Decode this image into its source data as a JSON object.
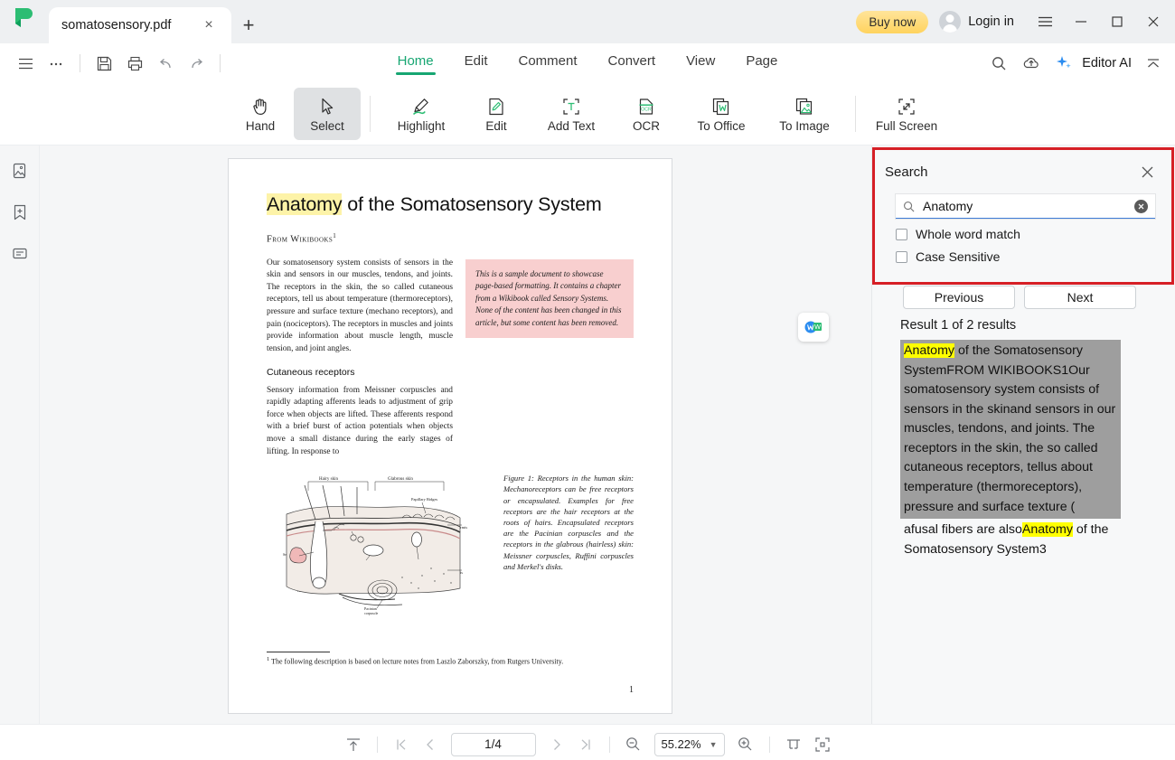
{
  "titlebar": {
    "logo_name": "app-logo",
    "tab_title": "somatosensory.pdf",
    "close_label": "×",
    "newtab_label": "+",
    "buy_now": "Buy now",
    "login": "Login in",
    "minimize": "—",
    "maximize": "□",
    "close": "×"
  },
  "ribbon": {
    "menus": [
      {
        "label": "Home",
        "active": true
      },
      {
        "label": "Edit",
        "active": false
      },
      {
        "label": "Comment",
        "active": false
      },
      {
        "label": "Convert",
        "active": false
      },
      {
        "label": "View",
        "active": false
      },
      {
        "label": "Page",
        "active": false
      }
    ],
    "editor_ai": "Editor AI",
    "accent": "#17a672"
  },
  "tools": [
    {
      "label": "Hand",
      "icon": "hand-icon",
      "selected": false
    },
    {
      "label": "Select",
      "icon": "cursor-icon",
      "selected": true
    },
    {
      "label": "Highlight",
      "icon": "highlighter-icon",
      "selected": false
    },
    {
      "label": "Edit",
      "icon": "edit-page-icon",
      "selected": false
    },
    {
      "label": "Add Text",
      "icon": "add-text-icon",
      "selected": false
    },
    {
      "label": "OCR",
      "icon": "ocr-icon",
      "selected": false
    },
    {
      "label": "To Office",
      "icon": "to-office-icon",
      "selected": false
    },
    {
      "label": "To Image",
      "icon": "to-image-icon",
      "selected": false
    },
    {
      "label": "Full Screen",
      "icon": "full-screen-icon",
      "selected": false
    }
  ],
  "document": {
    "title_highlight": "Anatomy",
    "title_rest": " of the Somatosensory System",
    "from": "From Wikibooks",
    "from_sup": "1",
    "paragraph1": "Our somatosensory system consists of sensors in the skin and sensors in our muscles, tendons, and joints. The receptors in the skin, the so called cutaneous receptors, tell us about temperature (thermoreceptors), pressure and surface texture (mechano receptors), and pain (nociceptors). The receptors in muscles and joints provide information about muscle length, muscle tension, and joint angles.",
    "callout": "This is a sample document to showcase page-based formatting. It contains a chapter from a Wikibook called Sensory Systems. None of the content has been changed in this article, but some content has been removed.",
    "heading2": "Cutaneous receptors",
    "paragraph2": "Sensory information from Meissner corpuscles and rapidly adapting afferents leads to adjustment of grip force when objects are lifted. These afferents respond with a brief burst of action potentials when objects move a small distance during the early stages of lifting. In response to",
    "figure_caption": "Figure 1: Receptors in the human skin: Mechanoreceptors can be free receptors or encapsulated. Examples for free receptors are the hair receptors at the roots of hairs. Encapsulated receptors are the Pacinian corpuscles and the receptors in the glabrous (hairless) skin: Meissner corpuscles, Ruffini corpuscles and Merkel's disks.",
    "figure_labels": [
      "Hairy skin",
      "Glabrous skin",
      "Papillary Ridges",
      "Epidermis",
      "Free nerve ending",
      "Merkel's disk",
      "Dermis",
      "Sebaceous gland",
      "Ruffini corpuscle",
      "Meissner's corpuscle",
      "Hair receptor",
      "Pacinian corpuscle"
    ],
    "footnote_sup": "1",
    "footnote": "The following description is based on lecture notes from Laszlo Zaborszky, from Rutgers University.",
    "page_number": "1",
    "word_badge": "word-export-badge"
  },
  "search": {
    "title": "Search",
    "query": "Anatomy",
    "placeholder": "Search",
    "clear_label": "×",
    "whole_word_label": "Whole word match",
    "whole_word_checked": false,
    "case_sensitive_label": "Case Sensitive",
    "case_sensitive_checked": false,
    "previous_label": "Previous",
    "next_label": "Next",
    "result_count": "Result 1 of 2 results",
    "highlight_color": "#ffff00",
    "outline_color": "#d61f26",
    "results": [
      {
        "active": true,
        "pre": "",
        "hit": "Anatomy",
        "post": " of the Somatosensory SystemFROM WIKIBOOKS1Our somatosensory system consists of sensors in the skinand sensors in our muscles, tendons, and joints. The receptors in the skin, the so called cutaneous receptors, tellus about temperature (thermoreceptors), pressure and surface texture ("
      },
      {
        "active": false,
        "pre": "afusal fibers are also",
        "hit": "Anatomy",
        "post": " of the Somatosensory System3"
      }
    ]
  },
  "statusbar": {
    "fit_label": "fit-page-icon",
    "first_page": "first-page-icon",
    "prev_page": "prev-page-icon",
    "page_value": "1/4",
    "next_page": "next-page-icon",
    "last_page": "last-page-icon",
    "zoom_out": "zoom-out-icon",
    "zoom_value": "55.22%",
    "zoom_in": "zoom-in-icon",
    "fit_width": "fit-width-icon",
    "fit_screen": "fit-screen-icon"
  },
  "leftrail": [
    {
      "name": "thumbnails-icon"
    },
    {
      "name": "bookmark-add-icon"
    },
    {
      "name": "comments-icon"
    }
  ],
  "rightrail": [
    {
      "name": "properties-panel-icon"
    }
  ]
}
